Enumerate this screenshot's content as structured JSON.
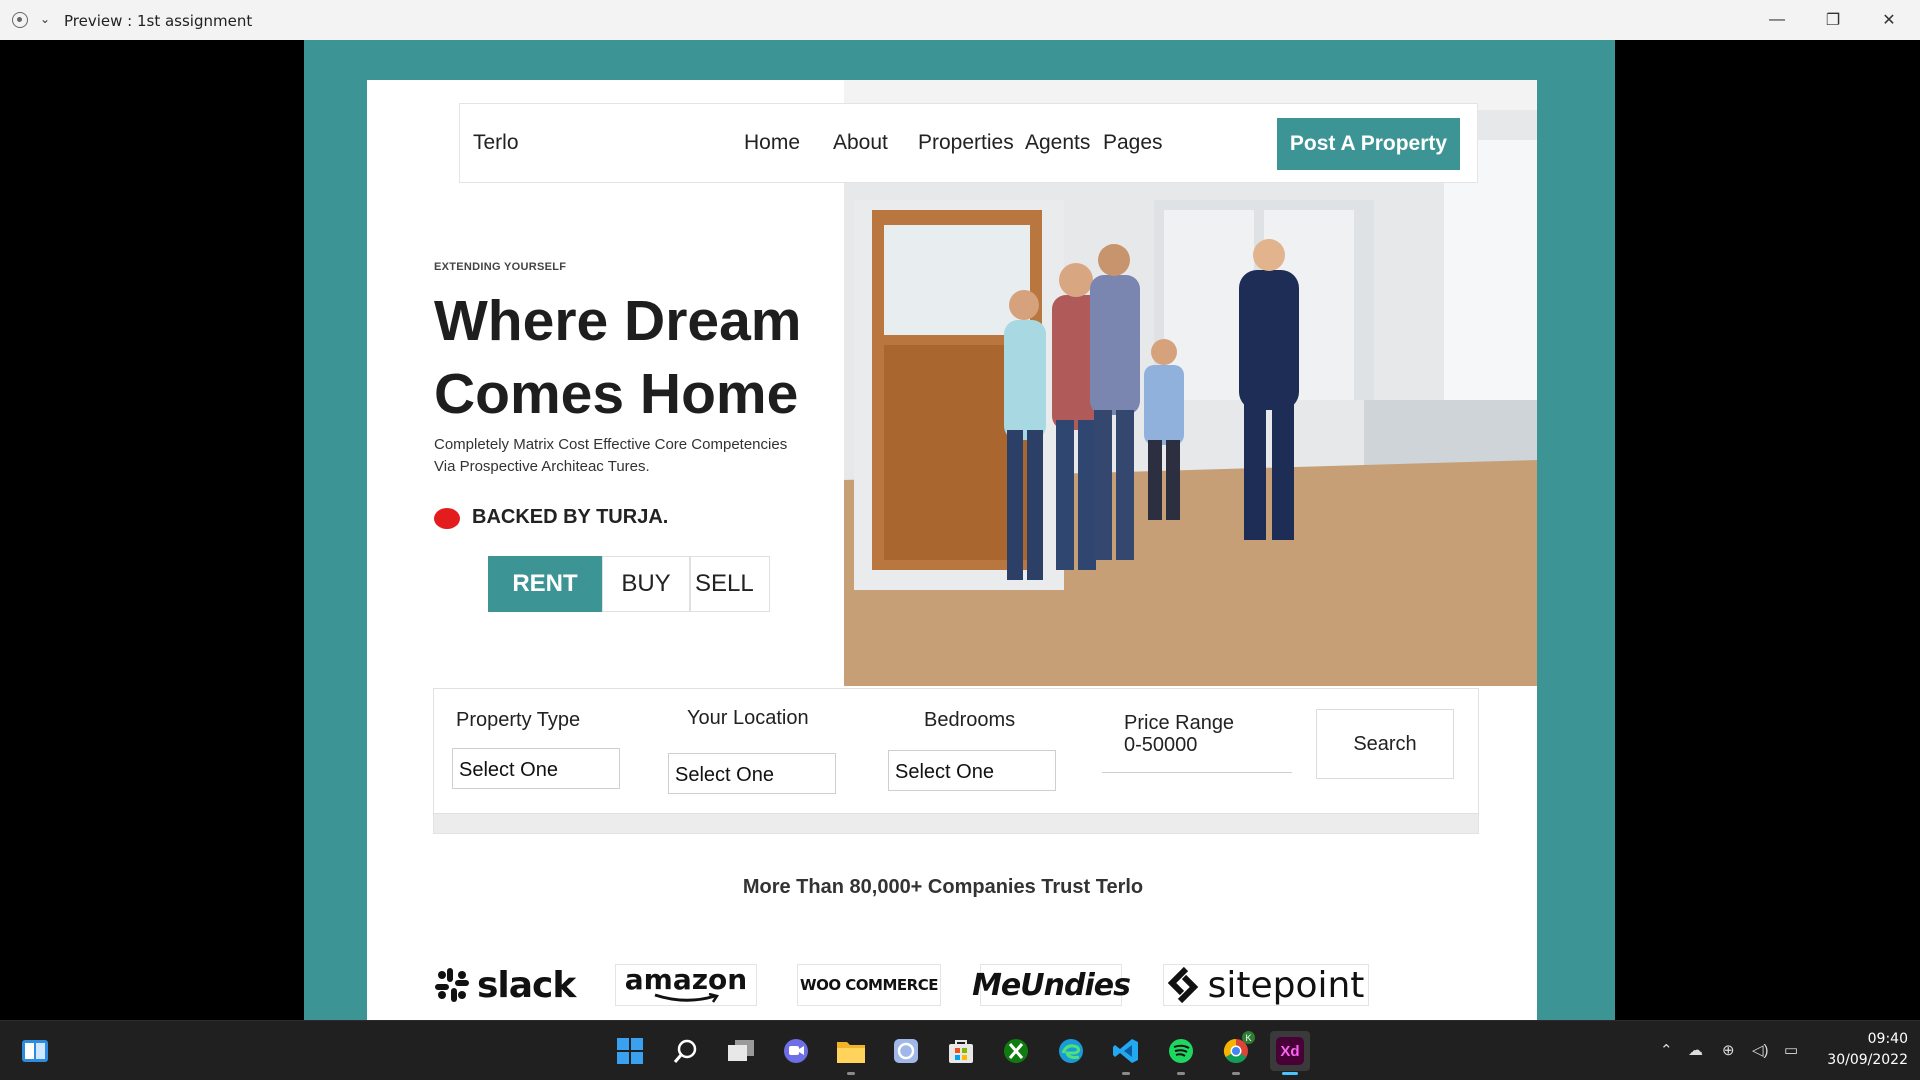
{
  "window": {
    "title": "Preview : 1st assignment",
    "controls": {
      "minimize": "—",
      "restore": "❐",
      "close": "✕"
    }
  },
  "site": {
    "brand": "Terlo",
    "nav": [
      "Home",
      "About",
      "Properties",
      "Agents",
      "Pages"
    ],
    "cta": "Post A Property",
    "eyebrow": "EXTENDING YOURSELF",
    "headline_line1": "Where Dream",
    "headline_line2": "Comes Home",
    "subtext_line1": "Completely Matrix Cost Effective Core Competencies",
    "subtext_line2": "Via Prospective Architeac Tures.",
    "backed": "BACKED BY TURJA.",
    "tabs": [
      "RENT",
      "BUY",
      "SELL"
    ],
    "active_tab": "RENT",
    "search": {
      "property_type_label": "Property Type",
      "property_type_value": "Select One",
      "location_label": "Your Location",
      "location_value": "Select One",
      "bedrooms_label": "Bedrooms",
      "bedrooms_value": "Select One",
      "price_label": "Price Range",
      "price_value": "0-50000",
      "button": "Search"
    },
    "trust_text": "More Than 80,000+ Companies Trust Terlo",
    "logos": [
      "slack",
      "amazon",
      "WOO COMMERCE",
      "MeUndies",
      "sitepoint"
    ],
    "colors": {
      "accent": "#3d9494",
      "dot": "#e31d1d"
    }
  },
  "taskbar": {
    "apps": [
      "windows-start-icon",
      "search-icon",
      "task-view-icon",
      "chat-icon",
      "file-explorer-icon",
      "photos-icon",
      "microsoft-store-icon",
      "xbox-icon",
      "edge-icon",
      "vscode-icon",
      "spotify-icon",
      "chrome-icon",
      "adobe-xd-icon"
    ],
    "xd_label": "Xd",
    "chrome_badge": "K",
    "time": "09:40",
    "date": "30/09/2022"
  }
}
